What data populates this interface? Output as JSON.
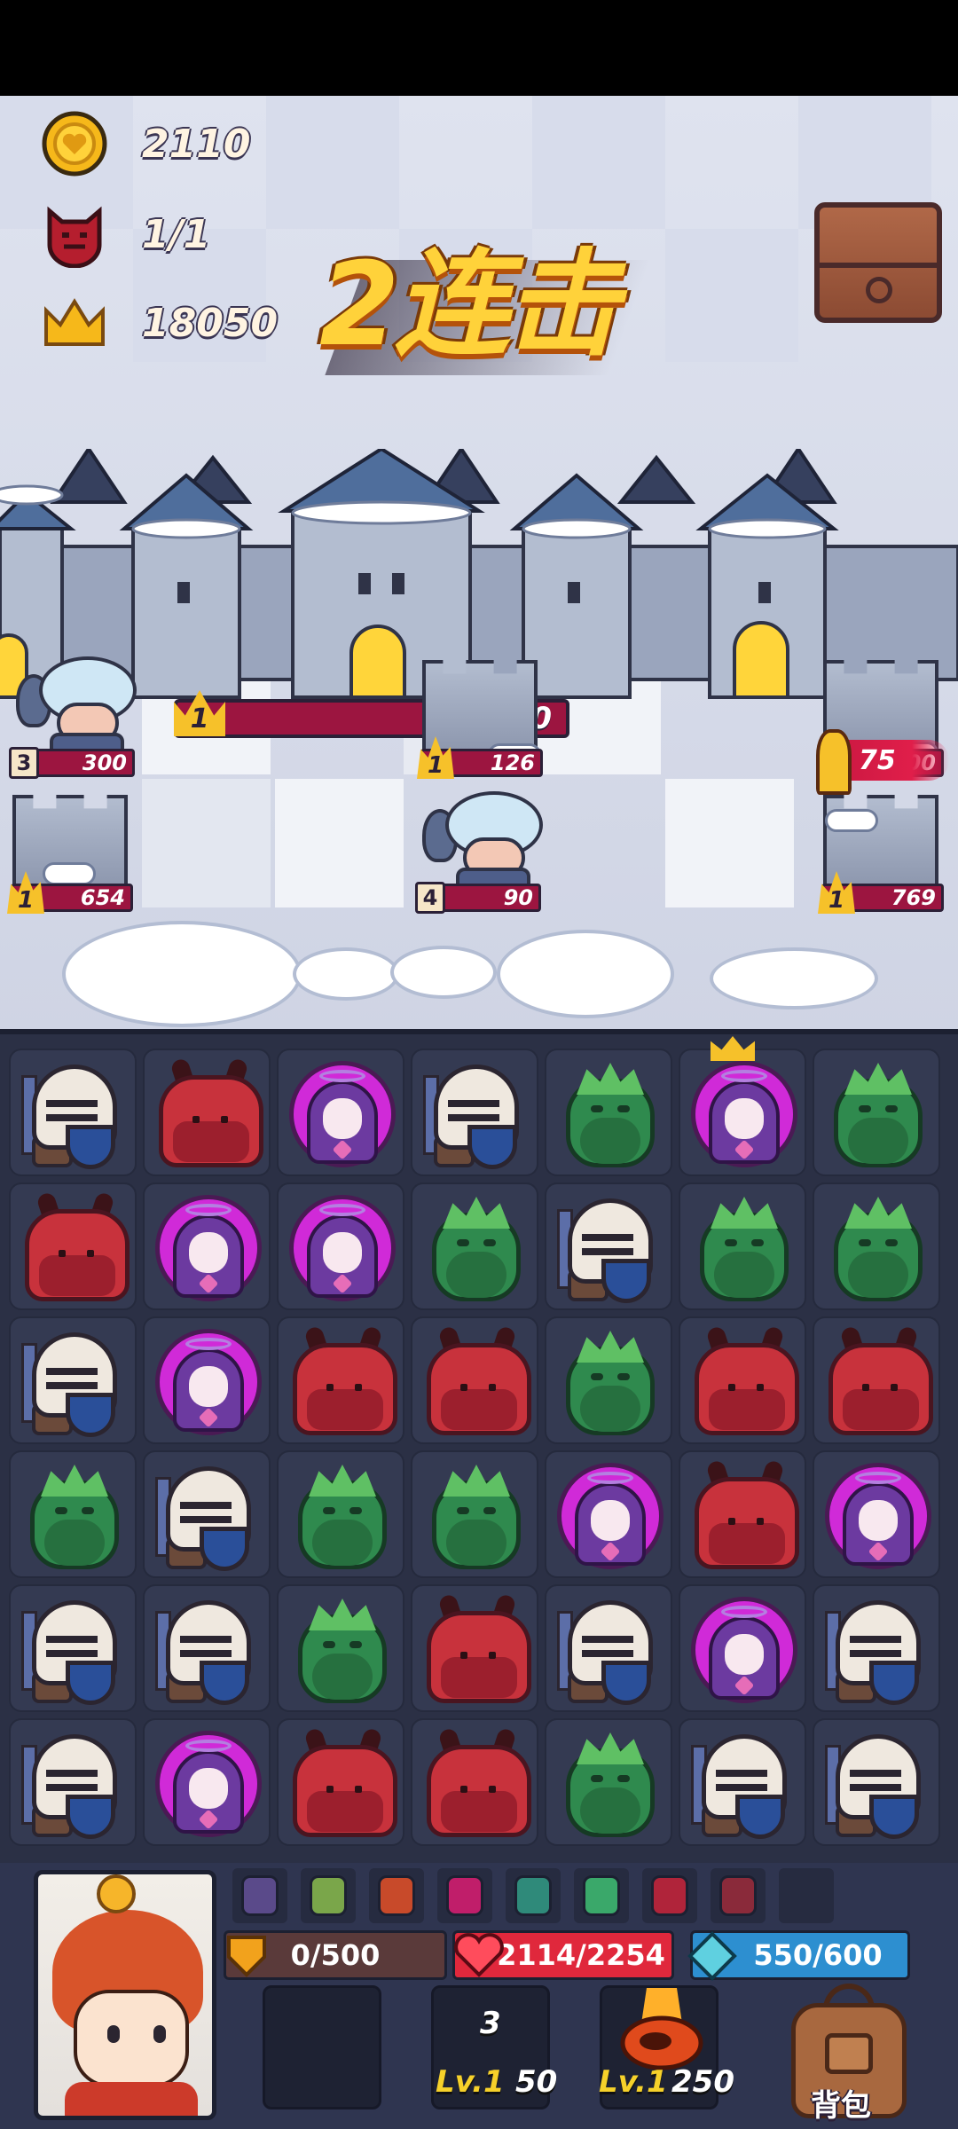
{
  "stats": {
    "gold": "2110",
    "demons": "1/1",
    "score": "18050"
  },
  "combo": {
    "text": "2连击"
  },
  "castle": {
    "level": "1",
    "hp": "4340"
  },
  "field_units": [
    {
      "kind": "miner",
      "level": "3",
      "hp": "300"
    },
    {
      "kind": "tower",
      "level": "1",
      "hp": "126"
    },
    {
      "kind": "tower",
      "level": "1",
      "hp": "800"
    },
    {
      "kind": "tower",
      "level": "1",
      "hp": "654"
    },
    {
      "kind": "miner",
      "level": "4",
      "hp": "90"
    },
    {
      "kind": "tower",
      "level": "1",
      "hp": "769"
    }
  ],
  "attack_tag": {
    "value": "75"
  },
  "board": {
    "rows": [
      [
        "knight",
        "demon",
        "angel",
        "knight",
        "owl",
        "angel",
        "owl"
      ],
      [
        "demon",
        "angel",
        "angel",
        "owl",
        "knight",
        "owl",
        "owl"
      ],
      [
        "knight",
        "angel",
        "demon",
        "demon",
        "owl",
        "demon",
        "demon"
      ],
      [
        "owl",
        "knight",
        "owl",
        "owl",
        "angel",
        "demon",
        "angel"
      ],
      [
        "knight",
        "knight",
        "owl",
        "demon",
        "knight",
        "angel",
        "knight"
      ],
      [
        "knight",
        "angel",
        "demon",
        "demon",
        "owl",
        "knight",
        "knight"
      ]
    ],
    "crowned_tile": "row 1, column 6"
  },
  "hud": {
    "shield": "0/500",
    "health": "2114/2254",
    "mana": "550/600",
    "items": [
      "potion-icon",
      "horn-icon",
      "scroll-icon",
      "skull-icon",
      "plant-icon",
      "book-icon",
      "bomb-icon",
      "amulet-icon",
      "empty-slot"
    ],
    "slot_count": "3",
    "slot1_level": "Lv.1",
    "slot1_cost": "50",
    "slot2_level": "Lv.1",
    "slot2_cost": "250",
    "bag_label": "背包"
  },
  "colors": {
    "gold": "#f6c12a",
    "hp_bar": "#9c1540",
    "health_bar": "#e0283c",
    "mana_bar": "#2d8fd0"
  }
}
